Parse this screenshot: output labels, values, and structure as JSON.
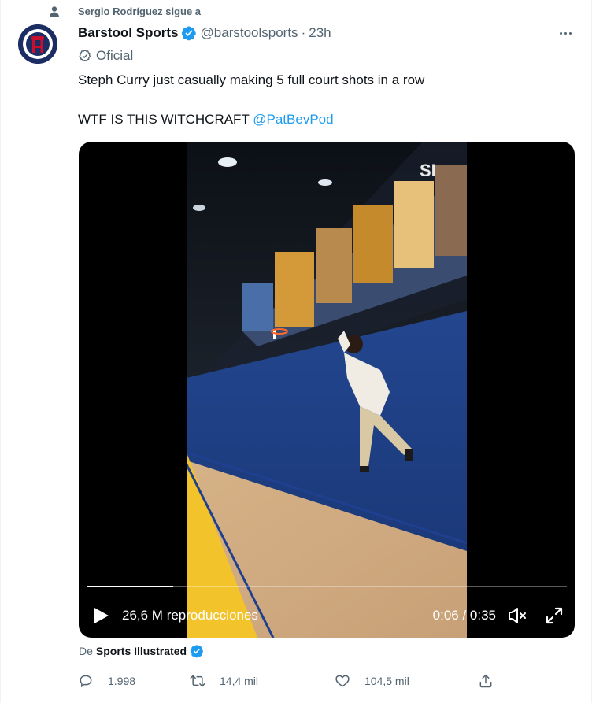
{
  "context": {
    "text": "Sergio Rodríguez sigue a",
    "icon": "person-icon"
  },
  "author": {
    "display_name": "Barstool Sports",
    "handle": "@barstoolsports",
    "separator": "·",
    "time": "23h",
    "label": "Oficial",
    "verified_color": "#1d9bf0"
  },
  "tweet": {
    "line1": "Steph Curry just casually making 5 full court shots in a row",
    "line2_text": "WTF IS THIS WITCHCRAFT ",
    "line2_mention": "@PatBevPod"
  },
  "video": {
    "views": "26,6 M reproducciones",
    "timecode": "0:06 / 0:35",
    "progress": 0.18,
    "watermark": "SI"
  },
  "source": {
    "prefix": "De",
    "name": "Sports Illustrated"
  },
  "actions": {
    "replies": "1.998",
    "retweets": "14,4 mil",
    "likes": "104,5 mil"
  },
  "colors": {
    "accent": "#1d9bf0",
    "secondary_text": "#536471",
    "court_yellow": "#f2c32a",
    "wall_blue": "#1f3f8f"
  }
}
